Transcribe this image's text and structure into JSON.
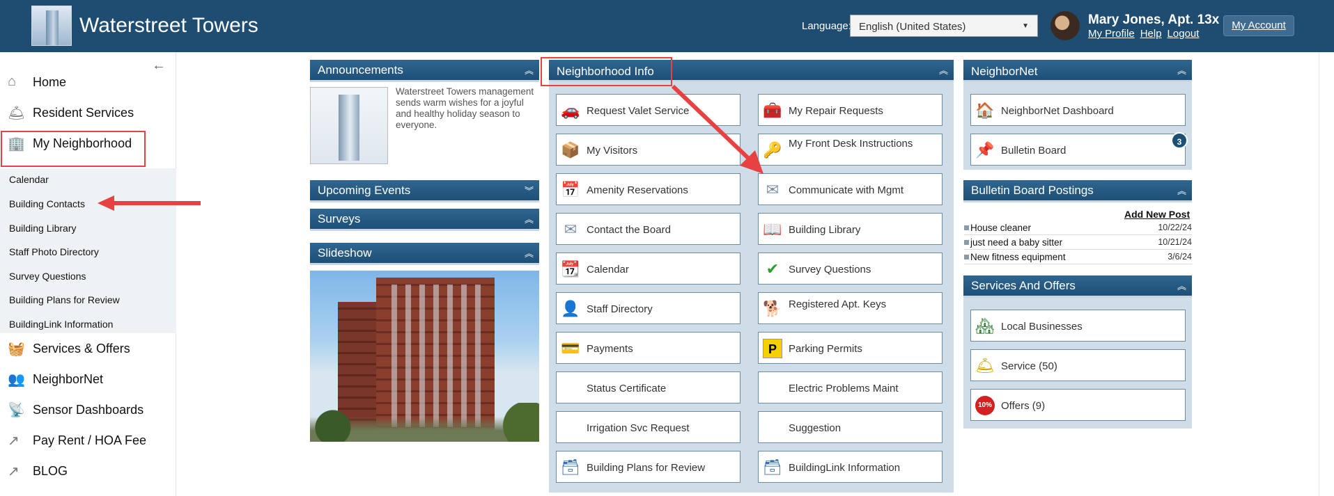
{
  "header": {
    "site_title": "Waterstreet Towers",
    "language_label": "Language:",
    "language_value": "English (United States)",
    "user_name": "Mary Jones, Apt. 13x",
    "links": [
      "My Profile",
      "Help",
      "Logout"
    ],
    "my_account": "My Account",
    "brand_color": "#1f4d72"
  },
  "sidebar": {
    "items": [
      {
        "label": "Home",
        "icon": "home-icon"
      },
      {
        "label": "Resident Services",
        "icon": "bell-icon"
      },
      {
        "label": "My Neighborhood",
        "icon": "building-icon"
      },
      {
        "label": "Services & Offers",
        "icon": "basket-icon"
      },
      {
        "label": "NeighborNet",
        "icon": "people-icon"
      },
      {
        "label": "Sensor Dashboards",
        "icon": "antenna-icon"
      },
      {
        "label": "Pay Rent / HOA Fee",
        "icon": "share-icon"
      },
      {
        "label": "BLOG",
        "icon": "share-icon"
      }
    ],
    "sub_items": [
      "Calendar",
      "Building Contacts",
      "Building Library",
      "Staff Photo Directory",
      "Survey Questions",
      "Building Plans for Review",
      "BuildingLink Information"
    ]
  },
  "announcements": {
    "title": "Announcements",
    "text": "Waterstreet Towers management sends warm wishes for a joyful and healthy holiday season to everyone."
  },
  "upcoming_events": {
    "title": "Upcoming Events"
  },
  "surveys": {
    "title": "Surveys"
  },
  "slideshow": {
    "title": "Slideshow"
  },
  "neighborhood_info": {
    "title": "Neighborhood Info",
    "tiles": [
      {
        "label": "Request Valet Service",
        "icon": "car-icon"
      },
      {
        "label": "My Repair Requests",
        "icon": "toolbox-icon"
      },
      {
        "label": "My Visitors",
        "icon": "package-icon"
      },
      {
        "label": "My Front Desk Instructions",
        "icon": "key-icon"
      },
      {
        "label": "Amenity Reservations",
        "icon": "calendar-grid-icon"
      },
      {
        "label": "Communicate with Mgmt",
        "icon": "envelope-icon"
      },
      {
        "label": "Contact the Board",
        "icon": "envelope-icon"
      },
      {
        "label": "Building Library",
        "icon": "book-icon"
      },
      {
        "label": "Calendar",
        "icon": "calendar-icon"
      },
      {
        "label": "Survey Questions",
        "icon": "checkmark-icon"
      },
      {
        "label": "Staff Directory",
        "icon": "person-icon"
      },
      {
        "label": "Registered Apt. Keys",
        "icon": "dog-icon"
      },
      {
        "label": "Payments",
        "icon": "credit-card-icon"
      },
      {
        "label": "Parking Permits",
        "icon": "parking-icon"
      },
      {
        "label": "Status Certificate",
        "icon": ""
      },
      {
        "label": "Electric Problems Maint",
        "icon": ""
      },
      {
        "label": "Irrigation Svc Request",
        "icon": ""
      },
      {
        "label": "Suggestion",
        "icon": ""
      },
      {
        "label": "Building Plans for Review",
        "icon": "box-icon"
      },
      {
        "label": "BuildingLink Information",
        "icon": "box-icon"
      }
    ]
  },
  "neighbornet": {
    "title": "NeighborNet",
    "tiles": [
      {
        "label": "NeighborNet Dashboard",
        "icon": "house-icon"
      },
      {
        "label": "Bulletin Board",
        "icon": "pushpin-icon",
        "badge": "3"
      }
    ]
  },
  "bulletin_postings": {
    "title": "Bulletin Board Postings",
    "add_new": "Add New Post",
    "posts": [
      {
        "title": "House cleaner",
        "date": "10/22/24"
      },
      {
        "title": "just need a baby sitter",
        "date": "10/21/24"
      },
      {
        "title": "New fitness equipment",
        "date": "3/6/24"
      }
    ]
  },
  "services_offers": {
    "title": "Services And Offers",
    "tiles": [
      {
        "label": "Local Businesses",
        "icon": "buildings-icon"
      },
      {
        "label": "Service (50)",
        "icon": "service-bell-icon"
      },
      {
        "label": "Offers (9)",
        "icon": "discount-icon"
      }
    ]
  },
  "annotation_color": "#e84141"
}
